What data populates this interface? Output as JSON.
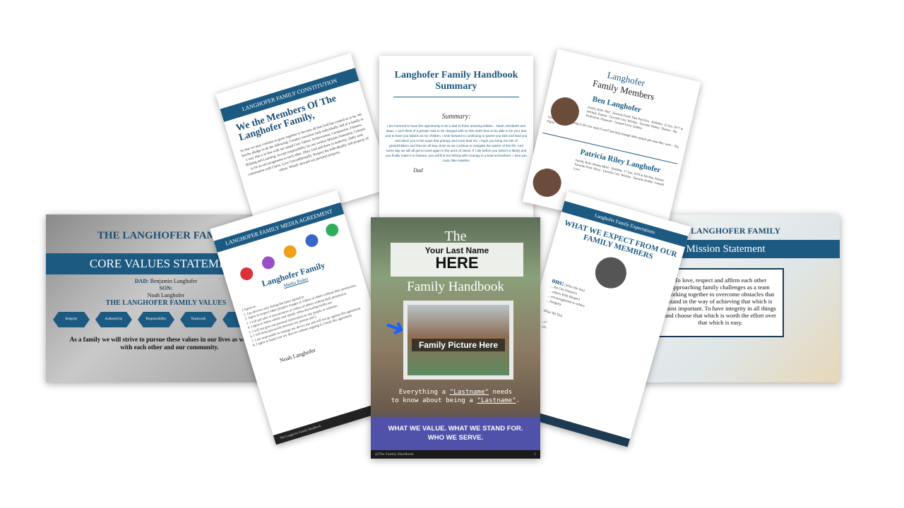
{
  "core": {
    "family_title": "THE LANGHOFER FAMILY",
    "statement_title": "CORE VALUES STATEMENT",
    "dad_label": "DAD:",
    "dad_name": "Benjamin Langhofer",
    "son_label": "SON:",
    "son_name": "Noah Langhofer",
    "values_heading": "THE LANGHOFER FAMILY VALUES",
    "values": [
      "Integrity",
      "Authenticity",
      "Responsibility",
      "Teamwork",
      "Tru"
    ],
    "footer": "As a family we will strive to pursue these values in our lives as we interact with each other and our community."
  },
  "constitution": {
    "header": "LANGHOFER FAMILY CONSTITUTION",
    "title": "We the Members Of The Langhofer Family,",
    "body": "So that we may continue to grow together to become all that God has created us to be. We hereby pledge to do the following: Conduct ourselves both individually and as a family in a way that is in line with our stated Core Values. Achievement, Compassion, Fairness, Helping and Learning. Accept responsibility for our written Mission Statement. Commit to be an encouragement to each other. Obey God and those in authority. Daily seek communion with Christ. Love Unconditionally. Respect the individuality and property of others. Wisely steward our personal property."
  },
  "summary": {
    "title": "Langhofer Family Handbook Summary",
    "subtitle": "Summary:",
    "text": "I am honored to have the opportunity to be a dad to three amazing kiddos... Noah, Elizabeth and Isaac. I can't think of a greater task to be charged with on this earth than to be able to be your dad and to have you kiddos as my children. I look forward to continuing to parent you kids and lead you and direct you in the ways that grampy and mom lead me. I hope you bring me lots of grandchildren and that we all stay close as we continue to navigate the waters of this life. And some day we will all get to meet again in the arms of Jesus. If I die before you (which is likely) and you finally make it to heaven, you will find me fishing with Grampy in a boat somewhere. I love you crazy little missiles.",
    "signature": "Dad"
  },
  "members": {
    "title_line1": "Langhofer",
    "title_line2": "Family Members",
    "member1_name": "Ben Langhofer",
    "member1_details": "Family Role: Dad · Favorite Food: Thai Pep Kim · Birthday: 12 Jun, 1977 in Wichita, Kansas · Favorite City: Wichita · Favorite Hobby: Theatre · My Profession: Financial · Ground Love: Spiders",
    "member1_quote": "You can have everything in life you want if you'll just help enough other people get what they want. - Zig Ziglar",
    "member2_name": "Patricia Riley Langhofer",
    "member2_details": "Family Role: Boston Mom · Birthday: 17 Jun, 1978 in Wichita, Kansas · Favorite Food: Pizza · Favorite City: Wichita · Favorite Hobby: Ground Love"
  },
  "media": {
    "header": "LANGHOFER FAMILY MEDIA AGREEMENT",
    "title": "Langhofer Family",
    "subtitle": "Media Rules",
    "agree": "I Agree to:",
    "items": [
      "1. Use devices only during the times agreed to.",
      "2. Agree to respect other people's images or videos of others without their permission.",
      "3. I will not take or post pictures or videos of others without their permission.",
      "4. I agree to listen calmly and openly when discussing media use.",
      "5. I will not give out personal information to any people or websites.",
      "6. I will keep passwords between my parents and I.",
      "7. I am responsible to manage my device use and will not go against this agreement.",
      "8. I agree to hand over my devices without arguing if I break this agreement."
    ],
    "signature": "Noah Langhofer",
    "footer": "The Langhofer Family Handbook"
  },
  "cover": {
    "the": "The",
    "your_last_name": "Your Last Name",
    "here": "HERE",
    "family_handbook": "Family Handbook",
    "family_picture": "Family Picture Here",
    "everything_1": "Everything a ",
    "lastname_1": "\"Lastname\"",
    "everything_2": " needs",
    "know_1": "to know about being a ",
    "lastname_2": "\"Lastname\"",
    "know_end": ".",
    "band_line1": "WHAT WE VALUE. WHAT WE STAND FOR.",
    "band_line2": "WHO WE SERVE.",
    "footer_left": "@The Family Handbook",
    "footer_right": "1"
  },
  "expect": {
    "header": "Langhofer Family Expectations",
    "title": "WHAT WE EXPECT FROM OUR FAMILY MEMBERS",
    "ons": "ons:",
    "who": "(Who We Are)",
    "items": [
      "…the Our Presence",
      "…others With Respect",
      "…encouragement to others",
      "…Integrity",
      "What We Do)",
      "…y?",
      "…do."
    ]
  },
  "mission": {
    "family_title": "THE LANGHOFER FAMILY",
    "title": "Mission Statement",
    "text": "To love, respect and affirm each other approaching family challenges as a team working together to overcome obstacles that stand in the way of achieving that which is most important. To have integrity in all things and choose that which is worth the effort over that which is easy."
  },
  "colors": {
    "brand_blue": "#1d5a82",
    "cover_band": "#4f52a8",
    "arrow_blue": "#1a5fff"
  }
}
